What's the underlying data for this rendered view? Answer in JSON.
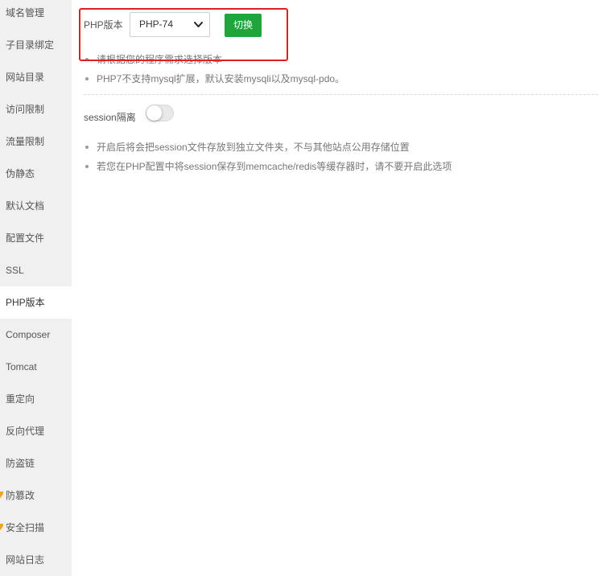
{
  "sidebar": {
    "items": [
      {
        "label": "域名管理",
        "active": false
      },
      {
        "label": "子目录绑定",
        "active": false
      },
      {
        "label": "网站目录",
        "active": false
      },
      {
        "label": "访问限制",
        "active": false
      },
      {
        "label": "流量限制",
        "active": false
      },
      {
        "label": "伪静态",
        "active": false
      },
      {
        "label": "默认文档",
        "active": false
      },
      {
        "label": "配置文件",
        "active": false
      },
      {
        "label": "SSL",
        "active": false
      },
      {
        "label": "PHP版本",
        "active": true
      },
      {
        "label": "Composer",
        "active": false
      },
      {
        "label": "Tomcat",
        "active": false
      },
      {
        "label": "重定向",
        "active": false
      },
      {
        "label": "反向代理",
        "active": false
      },
      {
        "label": "防盗链",
        "active": false
      },
      {
        "label": "防篡改",
        "active": false,
        "icon": "pro-badge-icon"
      },
      {
        "label": "安全扫描",
        "active": false,
        "icon": "pro-badge-icon"
      },
      {
        "label": "网站日志",
        "active": false
      }
    ]
  },
  "php_version": {
    "label": "PHP版本",
    "selected": "PHP-74",
    "switch_label": "切换",
    "notes": [
      "请根据您的程序需求选择版本",
      "PHP7不支持mysql扩展，默认安装mysqli以及mysql-pdo。"
    ]
  },
  "session_isolation": {
    "label": "session隔离",
    "enabled": false,
    "notes": [
      "开启后将会把session文件存放到独立文件夹，不与其他站点公用存储位置",
      "若您在PHP配置中将session保存到memcache/redis等缓存器时，请不要开启此选项"
    ]
  },
  "colors": {
    "accent": "#20a53a",
    "annotation_highlight": "#e02020",
    "sidebar_bg": "#f0f0f0",
    "pro_badge": "#f0a51e"
  }
}
